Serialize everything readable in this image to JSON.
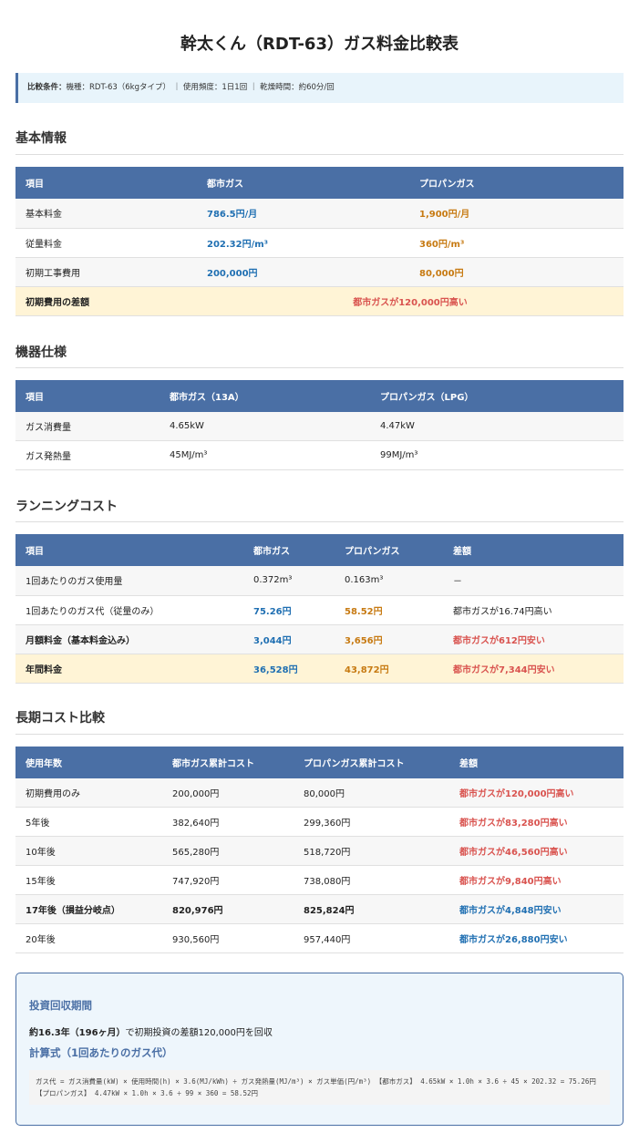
{
  "title": "幹太くん（RDT-63）ガス料金比較表",
  "conditions": {
    "label": "比較条件：",
    "text": "機種：RDT-63（6kgタイプ） ｜ 使用頻度：1日1回 ｜ 乾燥時間：約60分/回"
  },
  "basic": {
    "heading": "基本情報",
    "headers": [
      "項目",
      "都市ガス",
      "プロパンガス"
    ],
    "rows": [
      [
        "基本料金",
        "786.5円/月",
        "1,900円/月"
      ],
      [
        "従量料金",
        "202.32円/m³",
        "360円/m³"
      ],
      [
        "初期工事費用",
        "200,000円",
        "80,000円"
      ]
    ],
    "diff_label": "初期費用の差額",
    "diff_value": "都市ガスが120,000円高い"
  },
  "spec": {
    "heading": "機器仕様",
    "headers": [
      "項目",
      "都市ガス（13A）",
      "プロパンガス（LPG）"
    ],
    "rows": [
      [
        "ガス消費量",
        "4.65kW",
        "4.47kW"
      ],
      [
        "ガス発熱量",
        "45MJ/m³",
        "99MJ/m³"
      ]
    ]
  },
  "running": {
    "heading": "ランニングコスト",
    "headers": [
      "項目",
      "都市ガス",
      "プロパンガス",
      "差額"
    ],
    "rows": [
      [
        "1回あたりのガス使用量",
        "0.372m³",
        "0.163m³",
        "－"
      ],
      [
        "1回あたりのガス代（従量のみ）",
        "75.26円",
        "58.52円",
        "都市ガスが16.74円高い"
      ],
      [
        "月額料金（基本料金込み）",
        "3,044円",
        "3,656円",
        "都市ガスが612円安い"
      ],
      [
        "年間料金",
        "36,528円",
        "43,872円",
        "都市ガスが7,344円安い"
      ]
    ]
  },
  "longterm": {
    "heading": "長期コスト比較",
    "headers": [
      "使用年数",
      "都市ガス累計コスト",
      "プロパンガス累計コスト",
      "差額"
    ],
    "rows": [
      [
        "初期費用のみ",
        "200,000円",
        "80,000円",
        "都市ガスが120,000円高い"
      ],
      [
        "5年後",
        "382,640円",
        "299,360円",
        "都市ガスが83,280円高い"
      ],
      [
        "10年後",
        "565,280円",
        "518,720円",
        "都市ガスが46,560円高い"
      ],
      [
        "15年後",
        "747,920円",
        "738,080円",
        "都市ガスが9,840円高い"
      ],
      [
        "17年後（損益分岐点）",
        "820,976円",
        "825,824円",
        "都市ガスが4,848円安い"
      ],
      [
        "20年後",
        "930,560円",
        "957,440円",
        "都市ガスが26,880円安い"
      ]
    ]
  },
  "payback": {
    "heading": "投資回収期間",
    "strong": "約16.3年（196ヶ月）",
    "text": "で初期投資の差額120,000円を回収",
    "formula_heading": "計算式（1回あたりのガス代）",
    "formula": "ガス代 = ガス消費量(kW) × 使用時間(h) × 3.6(MJ/kWh) ÷ ガス発熱量(MJ/m³) × ガス単価(円/m³) 【都市ガス】 4.65kW × 1.0h × 3.6 ÷ 45 × 202.32 = 75.26円 【プロパンガス】 4.47kW × 1.0h × 3.6 ÷ 99 × 360 = 58.52円"
  },
  "colors": {
    "header_bg": "#4a6fa5",
    "city_gas": "#1f6fb2",
    "propane": "#c77a12",
    "warning": "#d9534f",
    "highlight_row": "#fff4d6"
  }
}
